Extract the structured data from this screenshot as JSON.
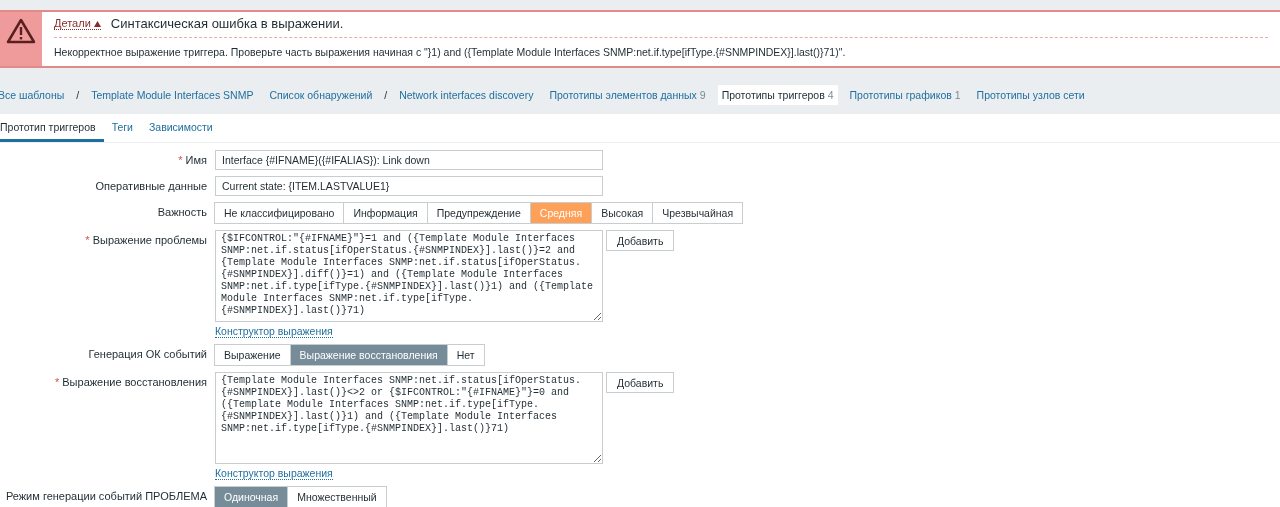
{
  "error": {
    "details_link": "Детали",
    "title": "Синтаксическая ошибка в выражении.",
    "message": "Некорректное выражение триггера. Проверьте часть выражения начиная с \"}1) and ({Template Module Interfaces SNMP:net.if.type[ifType.{#SNMPINDEX}].last()}71)\"."
  },
  "breadcrumbs": [
    {
      "label": "Все шаблоны",
      "separator": "/",
      "selected": false
    },
    {
      "label": "Template Module Interfaces SNMP",
      "selected": false
    },
    {
      "label": "Список обнаружений",
      "separator": "/",
      "selected": false
    },
    {
      "label": "Network interfaces discovery",
      "selected": false
    },
    {
      "label": "Прототипы элементов данных",
      "count": "9",
      "selected": false
    },
    {
      "label": "Прототипы триггеров",
      "count": "4",
      "selected": true
    },
    {
      "label": "Прототипы графиков",
      "count": "1",
      "selected": false
    },
    {
      "label": "Прототипы узлов сети",
      "selected": false
    }
  ],
  "tabs": [
    {
      "label": "Прототип триггеров",
      "selected": true
    },
    {
      "label": "Теги",
      "selected": false
    },
    {
      "label": "Зависимости",
      "selected": false
    }
  ],
  "form": [
    {
      "kind": "text",
      "label": "Имя",
      "required_mark": "*",
      "value": "Interface {#IFNAME}({#IFALIAS}): Link down"
    },
    {
      "kind": "text",
      "label": "Оперативные данные",
      "value": "Current state: {ITEM.LASTVALUE1}"
    },
    {
      "kind": "segmented",
      "label": "Важность",
      "options": [
        {
          "label": "Не классифицировано",
          "selected": false
        },
        {
          "label": "Информация",
          "selected": false
        },
        {
          "label": "Предупреждение",
          "selected": false
        },
        {
          "label": "Средняя",
          "selected": true,
          "color": "#ffa059"
        },
        {
          "label": "Высокая",
          "selected": false
        },
        {
          "label": "Чрезвычайная",
          "selected": false
        }
      ]
    },
    {
      "kind": "expression",
      "label": "Выражение проблемы",
      "required_mark": "*",
      "value": "{$IFCONTROL:\"{#IFNAME}\"}=1 and ({Template Module Interfaces SNMP:net.if.status[ifOperStatus.{#SNMPINDEX}].last()}=2 and {Template Module Interfaces SNMP:net.if.status[ifOperStatus.{#SNMPINDEX}].diff()}=1) and ({Template Module Interfaces SNMP:net.if.type[ifType.{#SNMPINDEX}].last()}1) and ({Template Module Interfaces SNMP:net.if.type[ifType.{#SNMPINDEX}].last()}71)",
      "button": "Добавить",
      "link": "Конструктор выражения"
    },
    {
      "kind": "segmented",
      "label": "Генерация ОК событий",
      "options": [
        {
          "label": "Выражение",
          "selected": false
        },
        {
          "label": "Выражение восстановления",
          "selected": true,
          "color": "#768d99"
        },
        {
          "label": "Нет",
          "selected": false
        }
      ]
    },
    {
      "kind": "expression",
      "label": "Выражение восстановления",
      "required_mark": "*",
      "value": "{Template Module Interfaces SNMP:net.if.status[ifOperStatus.{#SNMPINDEX}].last()}<>2 or {$IFCONTROL:\"{#IFNAME}\"}=0 and ({Template Module Interfaces SNMP:net.if.type[ifType.{#SNMPINDEX}].last()}1) and ({Template Module Interfaces SNMP:net.if.type[ifType.{#SNMPINDEX}].last()}71)",
      "button": "Добавить",
      "link": "Конструктор выражения"
    },
    {
      "kind": "segmented",
      "label": "Режим генерации событий ПРОБЛЕМА",
      "options": [
        {
          "label": "Одиночная",
          "selected": true,
          "color": "#768d99"
        },
        {
          "label": "Множественный",
          "selected": false
        }
      ]
    }
  ]
}
